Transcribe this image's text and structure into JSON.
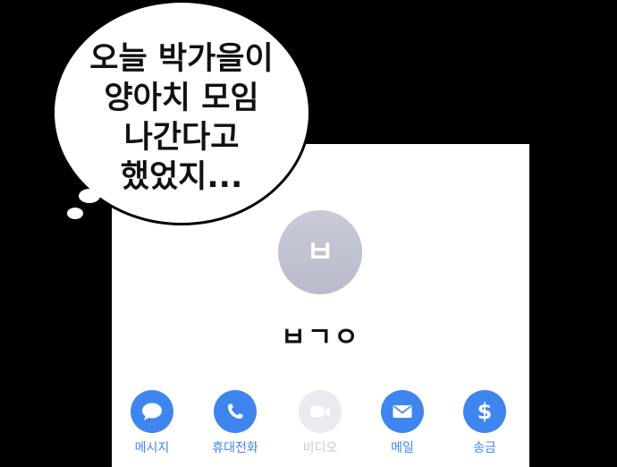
{
  "speech_bubble": {
    "lines": [
      "오늘 박가을이",
      "양아치 모임",
      "나간다고",
      "했었지..."
    ]
  },
  "contact": {
    "avatar_letter": "ㅂ",
    "name": "ㅂㄱㅇ"
  },
  "actions": [
    {
      "label": "메시지",
      "icon": "message-icon",
      "enabled": true
    },
    {
      "label": "휴대전화",
      "icon": "phone-icon",
      "enabled": true
    },
    {
      "label": "비디오",
      "icon": "video-icon",
      "enabled": false
    },
    {
      "label": "메일",
      "icon": "mail-icon",
      "enabled": true
    },
    {
      "label": "송금",
      "icon": "dollar-icon",
      "enabled": true
    }
  ],
  "colors": {
    "action_blue": "#3f85ef",
    "action_disabled": "#e9ebf0",
    "avatar_gray": "#bfc0d0",
    "background": "#000000"
  }
}
